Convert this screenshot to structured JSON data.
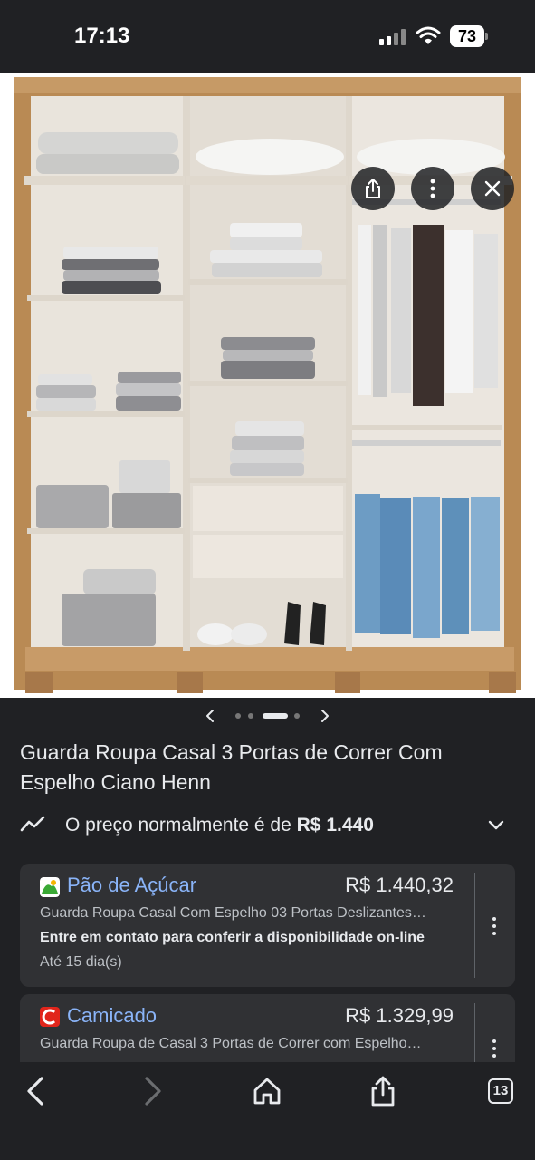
{
  "status_bar": {
    "time": "17:13",
    "battery": "73",
    "icons": [
      "cellular-signal-icon",
      "wifi-icon",
      "battery-icon"
    ]
  },
  "image_viewer": {
    "image_description": "product-photo-wardrobe",
    "buttons": [
      "share-icon",
      "more-vertical-icon",
      "close-icon"
    ],
    "carousel": {
      "dots": 4,
      "active_index": 2
    }
  },
  "product": {
    "title": "Guarda Roupa Casal 3 Portas de Correr Com Espelho Ciano Henn",
    "price_prefix": "O preço normalmente é de ",
    "price_value": "R$ 1.440"
  },
  "offers": [
    {
      "store": "Pão de Açúcar",
      "price": "R$ 1.440,32",
      "description": "Guarda Roupa Casal Com Espelho 03 Portas Deslizantes…",
      "availability": "Entre em contato para conferir a disponibilidade on-line",
      "shipping": "Até 15 dia(s)",
      "logo_color": "#3aa935"
    },
    {
      "store": "Camicado",
      "price": "R$ 1.329,99",
      "description": "Guarda Roupa de Casal 3 Portas de Correr com Espelho…",
      "logo_color": "#e1251b"
    }
  ],
  "bottom_bar": {
    "tabs_count": "13",
    "icons": [
      "back-icon",
      "forward-icon",
      "home-icon",
      "share-icon",
      "tabs-icon"
    ]
  },
  "colors": {
    "background": "#202124",
    "card": "#303134",
    "link": "#8ab4f8",
    "wood": "#b98a54",
    "panel": "#ece6de"
  }
}
